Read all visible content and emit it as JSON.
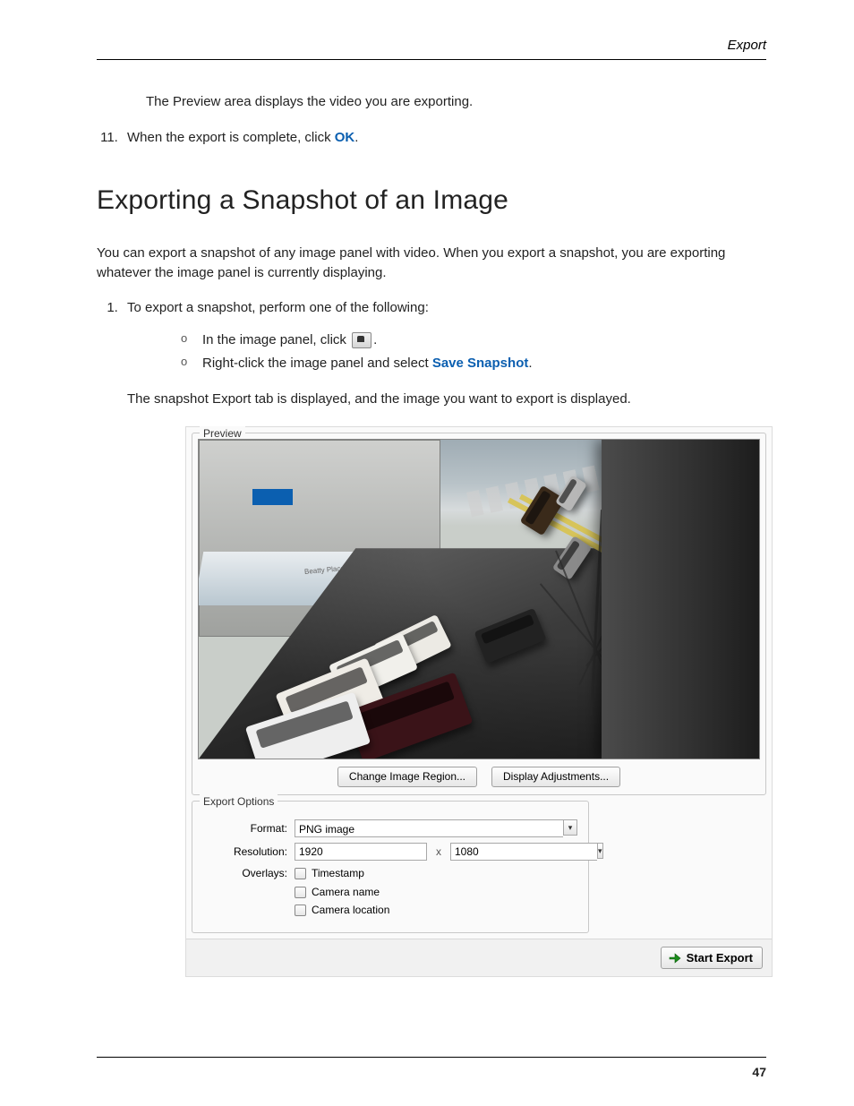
{
  "header": {
    "running_head": "Export"
  },
  "intro": {
    "preview_line": "The Preview area displays the video you are exporting.",
    "step11_prefix": "When the export is complete, click ",
    "step11_link": "OK",
    "step11_suffix": "."
  },
  "section": {
    "title": "Exporting a Snapshot of an Image",
    "para1": "You can export a snapshot of any image panel with video. When you export a snapshot, you are exporting whatever the image panel is currently displaying.",
    "step1": "To export a snapshot, perform one of the following:",
    "bullet_a_prefix": "In the image panel, click ",
    "bullet_a_suffix": ".",
    "bullet_b_prefix": "Right-click the image panel and select ",
    "bullet_b_link": "Save Snapshot",
    "bullet_b_suffix": ".",
    "after_bullets": "The snapshot Export tab is displayed, and the image you want to export is displayed."
  },
  "screenshot": {
    "preview_label": "Preview",
    "scene_store_label": "Beatty Place",
    "btn_change_region": "Change Image Region...",
    "btn_display_adjust": "Display Adjustments...",
    "options_label": "Export Options",
    "format_label": "Format:",
    "format_value": "PNG image",
    "resolution_label": "Resolution:",
    "resolution_w": "1920",
    "resolution_sep": "x",
    "resolution_h": "1080",
    "overlays_label": "Overlays:",
    "overlay_timestamp": "Timestamp",
    "overlay_camera_name": "Camera name",
    "overlay_camera_location": "Camera location",
    "start_export": "Start Export"
  },
  "footer": {
    "page_number": "47"
  }
}
